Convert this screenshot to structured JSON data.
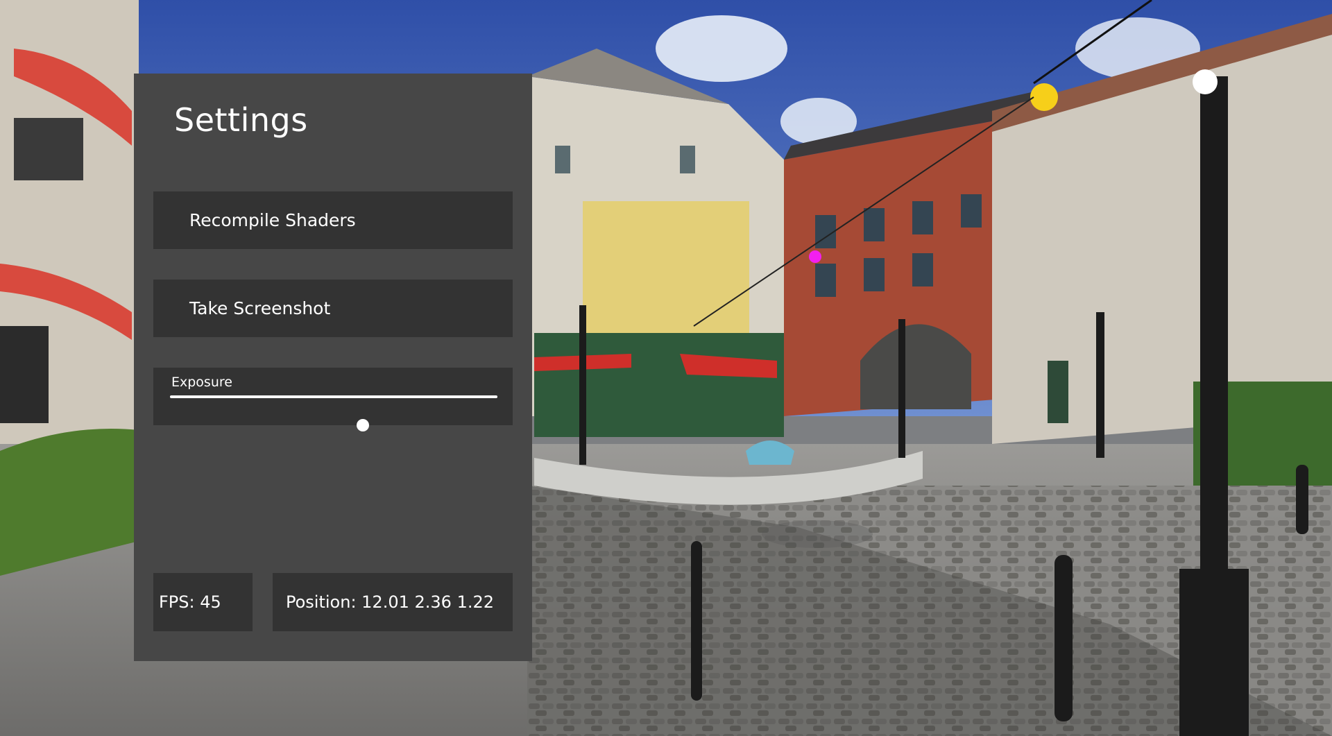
{
  "settings": {
    "title": "Settings",
    "recompile_label": "Recompile Shaders",
    "screenshot_label": "Take Screenshot",
    "exposure": {
      "label": "Exposure",
      "value_fraction": 0.59
    },
    "fps_text": "FPS: 45",
    "position_text": "Position: 12.01 2.36 1.22"
  },
  "colors": {
    "panel_bg": "#474747",
    "control_bg": "#333333",
    "text": "#ffffff"
  },
  "icons": {
    "slider_thumb": "circle"
  }
}
